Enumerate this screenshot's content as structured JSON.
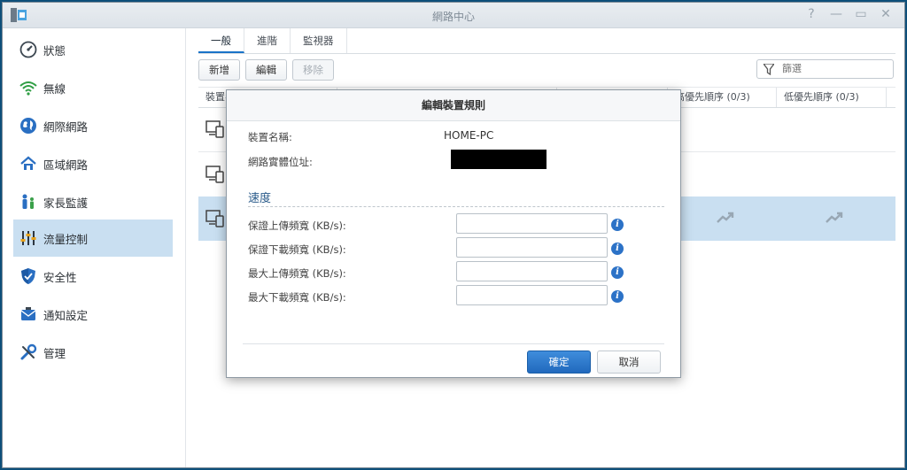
{
  "window": {
    "title": "網路中心",
    "controls": {
      "help": "?",
      "minimize": "—",
      "maximize": "▭",
      "close": "✕"
    }
  },
  "sidebar": {
    "items": [
      {
        "label": "狀態",
        "icon": "gauge-icon"
      },
      {
        "label": "無線",
        "icon": "wifi-icon"
      },
      {
        "label": "網際網路",
        "icon": "globe-icon"
      },
      {
        "label": "區域網路",
        "icon": "home-network-icon"
      },
      {
        "label": "家長監護",
        "icon": "family-icon"
      },
      {
        "label": "流量控制",
        "icon": "sliders-icon",
        "active": true
      },
      {
        "label": "安全性",
        "icon": "shield-icon"
      },
      {
        "label": "通知設定",
        "icon": "notification-icon"
      },
      {
        "label": "管理",
        "icon": "tools-icon"
      }
    ]
  },
  "main": {
    "tabs": [
      {
        "label": "一般",
        "active": true
      },
      {
        "label": "進階"
      },
      {
        "label": "監視器"
      }
    ],
    "toolbar": {
      "add": "新增",
      "edit": "編輯",
      "remove": "移除"
    },
    "filter": {
      "placeholder": "篩選"
    },
    "columns": {
      "device": "裝置名",
      "high_priority": "高優先順序 (0/3)",
      "low_priority": "低優先順序 (0/3)"
    }
  },
  "dialog": {
    "title": "編輯裝置規則",
    "device_name_label": "裝置名稱:",
    "device_name_value": "HOME-PC",
    "mac_label": "網路實體位址:",
    "section_speed": "速度",
    "fields": [
      {
        "label": "保證上傳頻寬 (KB/s):",
        "value": ""
      },
      {
        "label": "保證下載頻寬 (KB/s):",
        "value": ""
      },
      {
        "label": "最大上傳頻寬 (KB/s):",
        "value": ""
      },
      {
        "label": "最大下載頻寬 (KB/s):",
        "value": ""
      }
    ],
    "ok": "確定",
    "cancel": "取消"
  },
  "colors": {
    "accent": "#2169bd",
    "selected_row": "#c9dff1",
    "info_icon": "#2c72c7"
  }
}
